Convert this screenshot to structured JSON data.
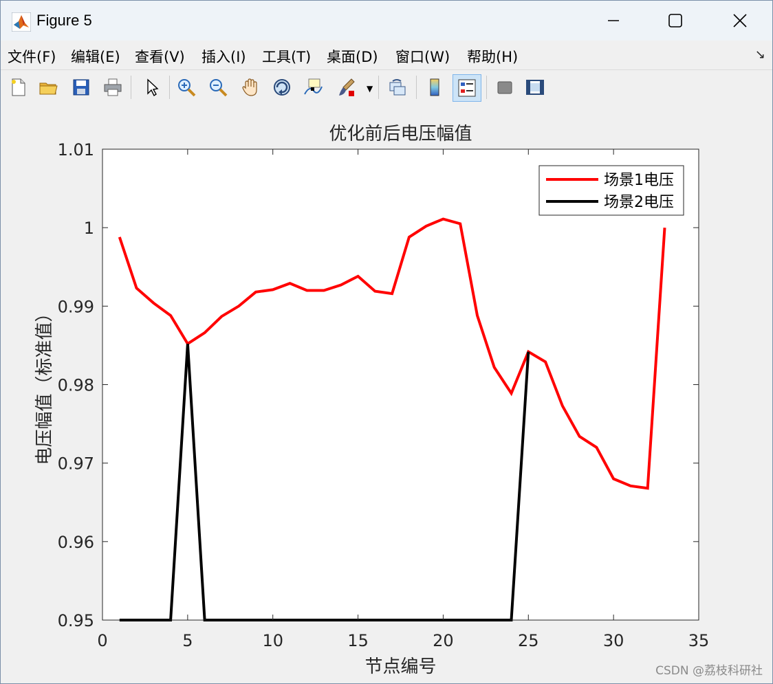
{
  "window": {
    "title": "Figure 5",
    "controls": {
      "minimize": "minimize",
      "maximize": "maximize",
      "close": "close"
    }
  },
  "menu": [
    {
      "label": "文件(F)"
    },
    {
      "label": "编辑(E)"
    },
    {
      "label": "查看(V)"
    },
    {
      "label": "插入(I)"
    },
    {
      "label": "工具(T)"
    },
    {
      "label": "桌面(D)"
    },
    {
      "label": "窗口(W)"
    },
    {
      "label": "帮助(H)"
    }
  ],
  "toolbar": {
    "icons": [
      "new-figure-icon",
      "open-file-icon",
      "save-icon",
      "print-icon",
      "pointer-icon",
      "zoom-in-icon",
      "zoom-out-icon",
      "pan-hand-icon",
      "rotate-3d-icon",
      "data-cursor-icon",
      "brush-icon",
      "link-plot-icon",
      "colorbar-icon",
      "legend-icon",
      "hide-plot-tools-icon",
      "show-plot-tools-icon"
    ],
    "active": "legend-icon"
  },
  "watermark": "CSDN @荔枝科研社",
  "chart_data": {
    "type": "line",
    "title": "优化前后电压幅值",
    "xlabel": "节点编号",
    "ylabel": "电压幅值（标准值）",
    "xlim": [
      0,
      35
    ],
    "ylim": [
      0.95,
      1.01
    ],
    "xticks": [
      0,
      5,
      10,
      15,
      20,
      25,
      30,
      35
    ],
    "yticks": [
      0.95,
      0.96,
      0.97,
      0.98,
      0.99,
      1,
      1.01
    ],
    "xtick_labels": [
      "0",
      "5",
      "10",
      "15",
      "20",
      "25",
      "30",
      "35"
    ],
    "ytick_labels": [
      "0.95",
      "0.96",
      "0.97",
      "0.98",
      "0.99",
      "1",
      "1.01"
    ],
    "legend_position": "top-right",
    "grid": false,
    "series": [
      {
        "name": "场景1电压",
        "color": "#ff0000",
        "x": [
          1,
          2,
          3,
          4,
          5,
          6,
          7,
          8,
          9,
          10,
          11,
          12,
          13,
          14,
          15,
          16,
          17,
          18,
          19,
          20,
          21,
          22,
          23,
          24,
          25,
          26,
          27,
          28,
          29,
          30,
          31,
          32,
          33
        ],
        "y": [
          0.9988,
          0.9923,
          0.9904,
          0.9888,
          0.9852,
          0.9866,
          0.9887,
          0.99,
          0.9918,
          0.9921,
          0.9929,
          0.992,
          0.992,
          0.9927,
          0.9938,
          0.9919,
          0.9916,
          0.9988,
          1.0002,
          1.0011,
          1.0005,
          0.9888,
          0.9822,
          0.9789,
          0.9842,
          0.9829,
          0.9773,
          0.9734,
          0.972,
          0.968,
          0.9671,
          0.9668,
          1.0
        ]
      },
      {
        "name": "场景2电压",
        "color": "#000000",
        "x": [
          1,
          2,
          3,
          4,
          5,
          6,
          7,
          8,
          9,
          10,
          11,
          12,
          13,
          14,
          15,
          16,
          17,
          18,
          19,
          20,
          21,
          22,
          23,
          24,
          25
        ],
        "y": [
          0.95,
          0.95,
          0.95,
          0.95,
          0.9852,
          0.95,
          0.95,
          0.95,
          0.95,
          0.95,
          0.95,
          0.95,
          0.95,
          0.95,
          0.95,
          0.95,
          0.95,
          0.95,
          0.95,
          0.95,
          0.95,
          0.95,
          0.95,
          0.95,
          0.9842
        ]
      }
    ]
  }
}
